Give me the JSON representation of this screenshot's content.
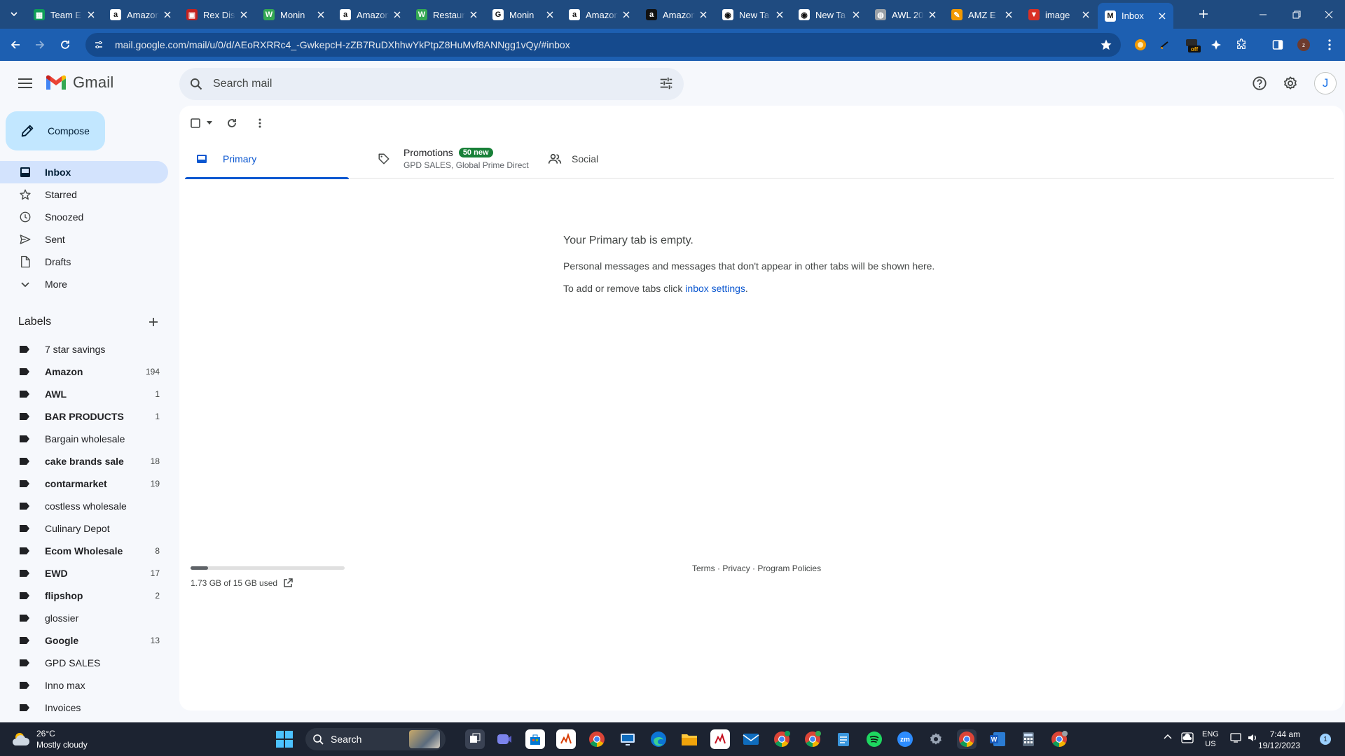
{
  "browser": {
    "tabs": [
      {
        "title": "Team E",
        "favicon": "sheets-icon",
        "color": "#0f9d58",
        "glyph": "▦"
      },
      {
        "title": "Amazon",
        "favicon": "amazon-icon",
        "color": "#ffffff",
        "glyph": "a"
      },
      {
        "title": "Rex Dis",
        "favicon": "rex-icon",
        "color": "#c5221f",
        "glyph": "▣"
      },
      {
        "title": "Monin",
        "favicon": "wix-icon",
        "color": "#34a853",
        "glyph": "W"
      },
      {
        "title": "Amazon",
        "favicon": "amazon-icon",
        "color": "#ffffff",
        "glyph": "a"
      },
      {
        "title": "Restaur",
        "favicon": "wix-icon",
        "color": "#34a853",
        "glyph": "W"
      },
      {
        "title": "Monin",
        "favicon": "google-icon",
        "color": "#ffffff",
        "glyph": "G"
      },
      {
        "title": "Amazon",
        "favicon": "amazon-icon",
        "color": "#ffffff",
        "glyph": "a"
      },
      {
        "title": "Amazon",
        "favicon": "amazon-icon",
        "color": "#111111",
        "glyph": "a"
      },
      {
        "title": "New Ta",
        "favicon": "chrome-icon",
        "color": "#ffffff",
        "glyph": "◉"
      },
      {
        "title": "New Ta",
        "favicon": "chrome-icon",
        "color": "#ffffff",
        "glyph": "◉"
      },
      {
        "title": "AWL 20",
        "favicon": "globe-icon",
        "color": "#9aa0a6",
        "glyph": "◍"
      },
      {
        "title": "AMZ E",
        "favicon": "pencil-icon",
        "color": "#f29900",
        "glyph": "✎"
      },
      {
        "title": "image",
        "favicon": "image-icon",
        "color": "#d93025",
        "glyph": "▼"
      },
      {
        "title": "Inbox",
        "favicon": "gmail-icon",
        "color": "#ffffff",
        "glyph": "M"
      }
    ],
    "url": "mail.google.com/mail/u/0/d/AEoRXRRc4_-GwkepcH-zZB7RuDXhhwYkPtpZ8HuMvf8ANNgg1vQy/#inbox"
  },
  "gmail": {
    "app_name": "Gmail",
    "search_placeholder": "Search mail",
    "avatar_initial": "J",
    "compose_label": "Compose",
    "nav": [
      {
        "label": "Inbox",
        "icon": "inbox-icon",
        "active": true
      },
      {
        "label": "Starred",
        "icon": "star-icon",
        "active": false
      },
      {
        "label": "Snoozed",
        "icon": "clock-icon",
        "active": false
      },
      {
        "label": "Sent",
        "icon": "send-icon",
        "active": false
      },
      {
        "label": "Drafts",
        "icon": "draft-icon",
        "active": false
      },
      {
        "label": "More",
        "icon": "chevron-down-icon",
        "active": false
      }
    ],
    "labels_title": "Labels",
    "labels": [
      {
        "name": "7 star savings",
        "count": "",
        "bold": false
      },
      {
        "name": "Amazon",
        "count": "194",
        "bold": true
      },
      {
        "name": "AWL",
        "count": "1",
        "bold": true
      },
      {
        "name": "BAR PRODUCTS",
        "count": "1",
        "bold": true
      },
      {
        "name": "Bargain wholesale",
        "count": "",
        "bold": false
      },
      {
        "name": "cake brands sale",
        "count": "18",
        "bold": true
      },
      {
        "name": "contarmarket",
        "count": "19",
        "bold": true
      },
      {
        "name": "costless wholesale",
        "count": "",
        "bold": false
      },
      {
        "name": "Culinary Depot",
        "count": "",
        "bold": false
      },
      {
        "name": "Ecom Wholesale",
        "count": "8",
        "bold": true
      },
      {
        "name": "EWD",
        "count": "17",
        "bold": true
      },
      {
        "name": "flipshop",
        "count": "2",
        "bold": true
      },
      {
        "name": "glossier",
        "count": "",
        "bold": false
      },
      {
        "name": "Google",
        "count": "13",
        "bold": true
      },
      {
        "name": "GPD SALES",
        "count": "",
        "bold": false
      },
      {
        "name": "Inno max",
        "count": "",
        "bold": false
      },
      {
        "name": "Invoices",
        "count": "",
        "bold": false
      }
    ],
    "tabs": {
      "primary": "Primary",
      "promotions": "Promotions",
      "promotions_badge": "50 new",
      "promotions_senders": "GPD SALES, Global Prime Direct",
      "social": "Social"
    },
    "empty": {
      "heading": "Your Primary tab is empty.",
      "line1": "Personal messages and messages that don't appear in other tabs will be shown here.",
      "line2_prefix": "To add or remove tabs click ",
      "line2_link": "inbox settings",
      "line2_suffix": "."
    },
    "storage": {
      "text": "1.73 GB of 15 GB used",
      "used_fraction": 0.115
    },
    "footer": {
      "terms": "Terms",
      "privacy": "Privacy",
      "policies": "Program Policies",
      "sep": "·"
    }
  },
  "taskbar": {
    "weather_temp": "26°C",
    "weather_desc": "Mostly cloudy",
    "search_label": "Search",
    "lang_line1": "ENG",
    "lang_line2": "US",
    "time": "7:44 am",
    "date": "19/12/2023",
    "notification_count": "1"
  }
}
